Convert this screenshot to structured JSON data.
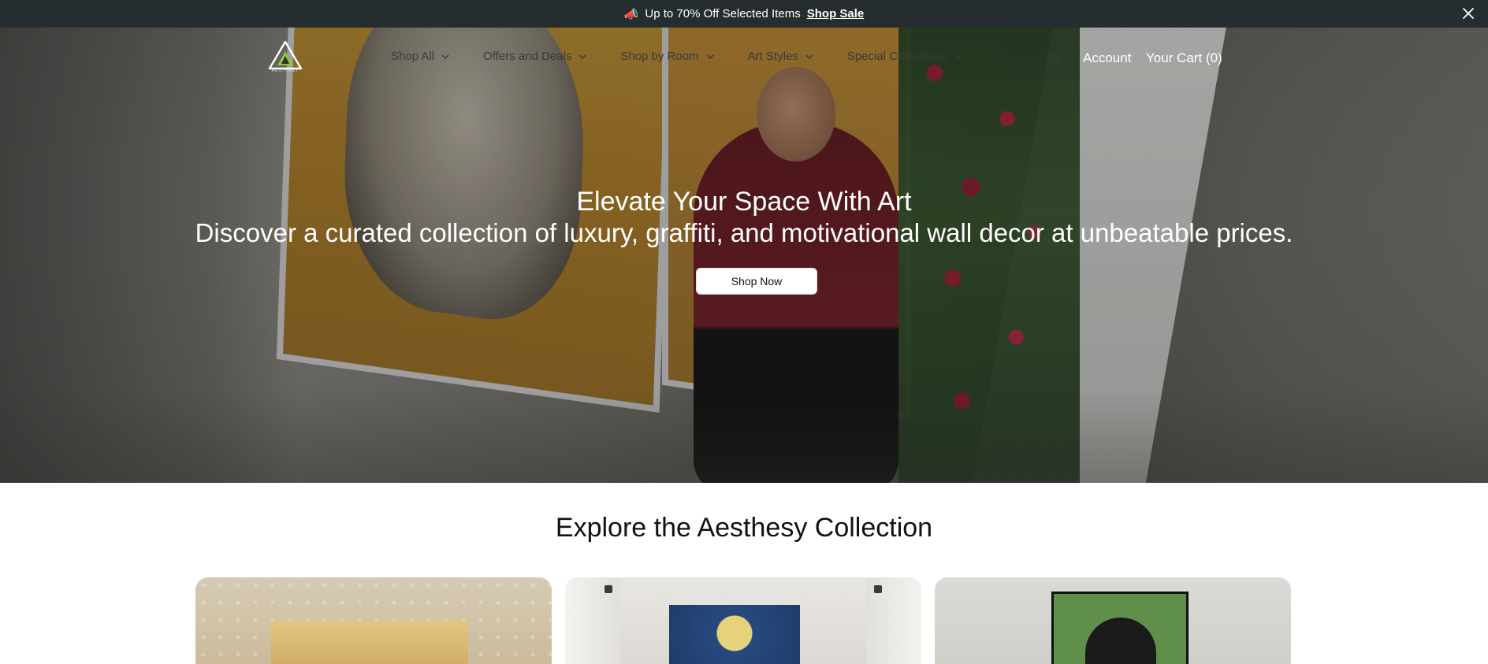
{
  "announcement": {
    "emoji": "📣",
    "text": "Up to 70% Off Selected Items",
    "link": "Shop Sale"
  },
  "header": {
    "brand": "AESTHESY",
    "nav": [
      {
        "label": "Shop All"
      },
      {
        "label": "Offers and Deals"
      },
      {
        "label": "Shop by Room"
      },
      {
        "label": "Art Styles"
      },
      {
        "label": "Special Collections"
      }
    ],
    "account": "Account",
    "cart": "Your Cart (0)"
  },
  "hero": {
    "title": "Elevate Your Space With Art",
    "subtitle": "Discover a curated collection of luxury, graffiti, and motivational wall decor at unbeatable prices.",
    "cta": "Shop Now"
  },
  "collection": {
    "title": "Explore the Aesthesy Collection"
  },
  "colors": {
    "announcement_bg": "#262d30",
    "logo_green": "#8cc63f"
  }
}
